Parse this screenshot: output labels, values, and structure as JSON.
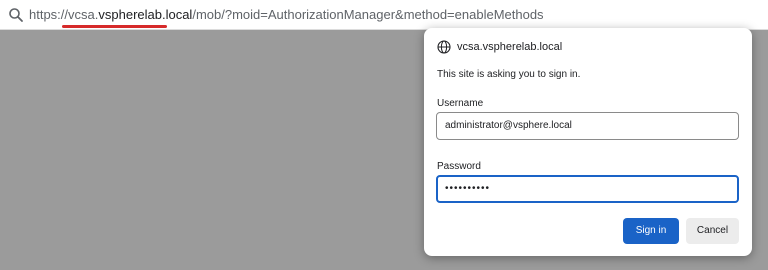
{
  "addressbar": {
    "icon": "search-icon",
    "url_scheme": "https://",
    "url_host_prefix": "vcsa.",
    "url_host_domain": "vspherelab.local",
    "url_path": "/mob/?moid=AuthorizationManager&method=enableMethods",
    "underline_color": "#d62a2a"
  },
  "dialog": {
    "site_icon": "globe-icon",
    "site": "vcsa.vspherelab.local",
    "prompt": "This site is asking you to sign in.",
    "username_label": "Username",
    "username_value": "administrator@vsphere.local",
    "password_label": "Password",
    "password_value": "••••••••••",
    "signin_label": "Sign in",
    "cancel_label": "Cancel",
    "accent_color": "#1a63c7"
  }
}
